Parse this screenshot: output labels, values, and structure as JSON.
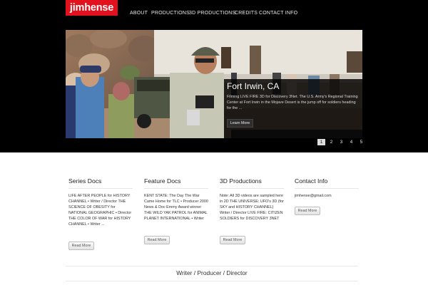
{
  "site": {
    "logo": "jimhense"
  },
  "nav": {
    "items": [
      "ABOUT",
      "PRODUCTIONS",
      "3D PRODUCTIONS",
      "CREDITS",
      "CONTACT INFO"
    ]
  },
  "slider": {
    "caption_title": "Fort Irwin, CA",
    "caption_text": "Filming LIVE FIRE 3D for Discovery 3Net.  The U.S. Army's Regional Training Center at Fort Irwin in the Mojave Desert is the jump off for soldiers heading for the ...",
    "button_label": "Learn More",
    "pages": [
      "1",
      "2",
      "3",
      "4",
      "5"
    ],
    "active_page": "1"
  },
  "columns": [
    {
      "title": "Series Docs",
      "text": "LIFE AFTER PEOPLE for HISTORY CHANNEL • Writer / Director THE SCIENCE OF OBESITY for NATIONAL GEOGRAPHIC • Director  THE COLOR OF WAR for HISTORY CHANNEL • Writer ...",
      "button": "Read More"
    },
    {
      "title": "Feature Docs",
      "text": "KENT STATE: The Day The War Came Home for TLC • Producer 2000 News & Doc Emmy Award winner  THE WILD YAK PATROL for ANIMAL PLANET INTERNATIONAL • Writer",
      "button": "Read More"
    },
    {
      "title": "3D Productions",
      "text": "Note: All 3D videos are sampled here in 2D  THE UNIVERSE: UFO's 3D (for SKY and HISTORY CHANNEL) Writer / Director LIVE FIRE: CITIZEN SOLDIERS for DISCOVERY 3NET",
      "button": "Read More"
    },
    {
      "title": "Contact Info",
      "text": "jimhense@gmail.com",
      "button": "Read More"
    }
  ],
  "footer": {
    "tagline": "Writer / Producer / Director"
  },
  "colors": {
    "logo_bg": "#e3101d",
    "header_bg": "#000000",
    "page_bg": "#ffffff"
  }
}
